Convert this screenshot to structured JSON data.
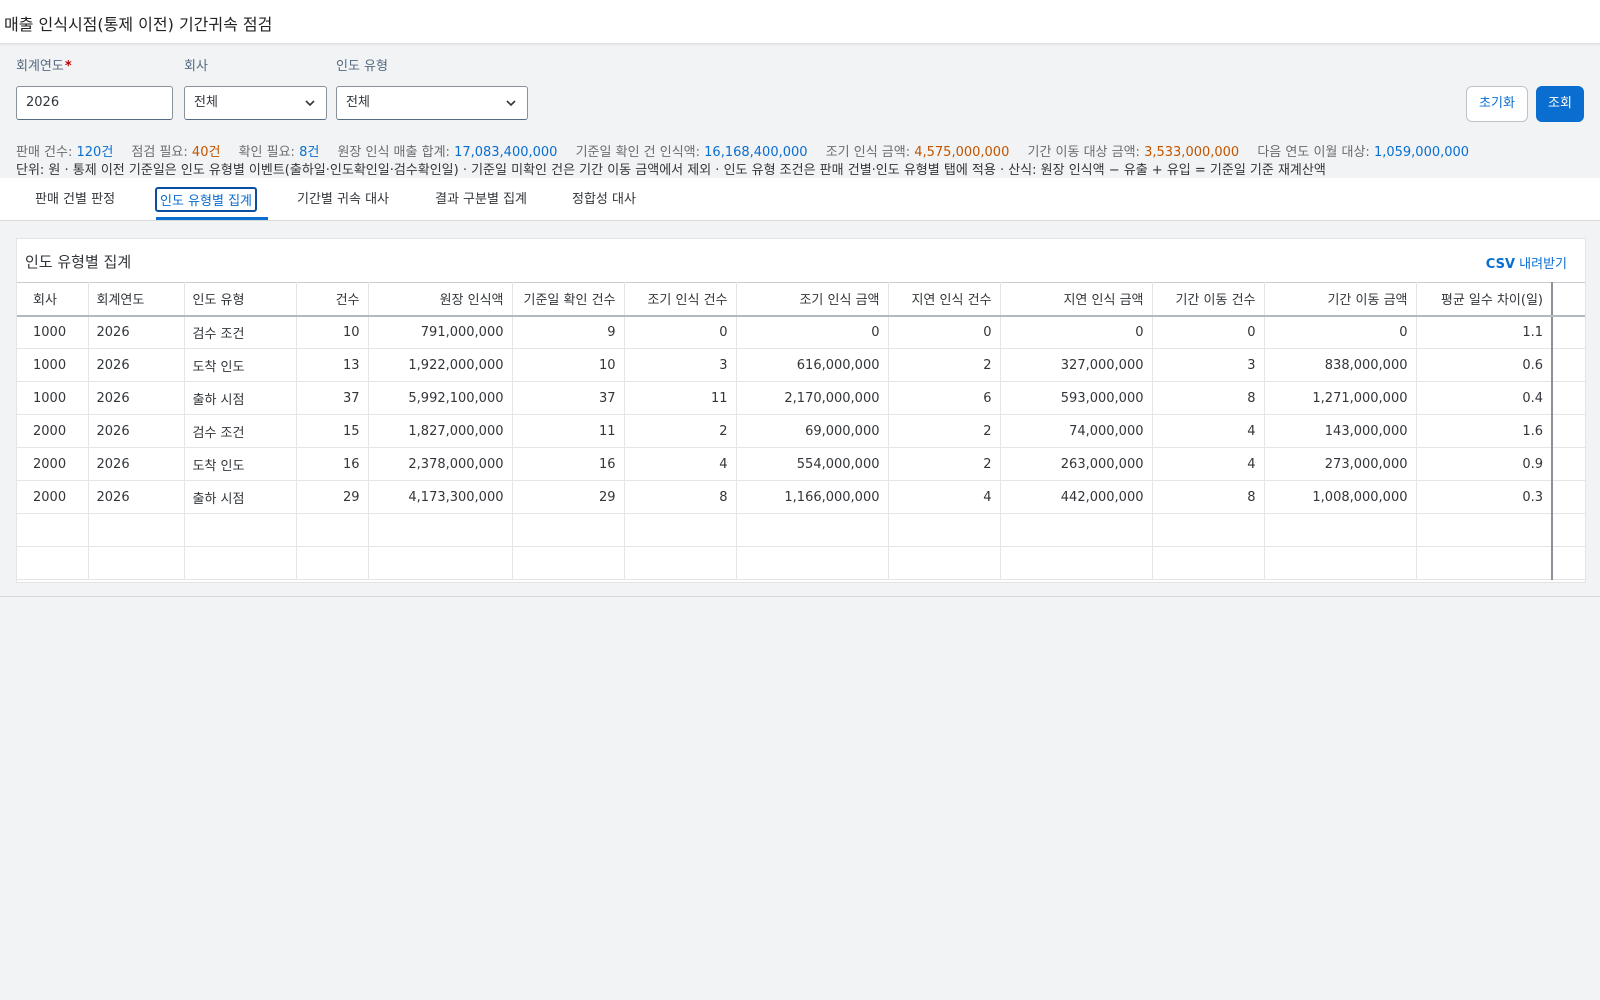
{
  "app": {
    "title": "매출 인식시점(통제 이전) 기간귀속 점검"
  },
  "filters": {
    "fiscal_year": {
      "label": "회계연도",
      "required_mark": "*",
      "value": "2026"
    },
    "company": {
      "label": "회사",
      "value": "전체"
    },
    "delivery_type": {
      "label": "인도 유형",
      "value": "전체"
    }
  },
  "buttons": {
    "reset": "초기화",
    "search": "조회"
  },
  "stats": [
    {
      "label": "판매 건수:",
      "value": "120건",
      "color": "#0a6ed1"
    },
    {
      "label": "점검 필요:",
      "value": "40건",
      "color": "#c35500"
    },
    {
      "label": "확인 필요:",
      "value": "8건",
      "color": "#0a6ed1"
    },
    {
      "label": "원장 인식 매출 합계:",
      "value": "17,083,400,000",
      "color": "#0a6ed1"
    },
    {
      "label": "기준일 확인 건 인식액:",
      "value": "16,168,400,000",
      "color": "#0a6ed1"
    },
    {
      "label": "조기 인식 금액:",
      "value": "4,575,000,000",
      "color": "#c35500"
    },
    {
      "label": "기간 이동 대상 금액:",
      "value": "3,533,000,000",
      "color": "#c35500"
    },
    {
      "label": "다음 연도 이월 대상:",
      "value": "1,059,000,000",
      "color": "#0a6ed1"
    }
  ],
  "unit_note": "단위: 원 · 통제 이전 기준일은 인도 유형별 이벤트(출하일·인도확인일·검수확인일) · 기준일 미확인 건은 기간 이동 금액에서 제외 · 인도 유형 조건은 판매 건별·인도 유형별 탭에 적용 · 산식: 원장 인식액 − 유출 + 유입 = 기준일 기준 재계산액",
  "tabs": {
    "by_sale": "판매 건별 판정",
    "by_delivery_type": "인도 유형별 집계",
    "by_period": "기간별 귀속 대사",
    "by_result": "결과 구분별 집계",
    "consistency": "정합성 대사",
    "active": "by_delivery_type"
  },
  "panel": {
    "title": "인도 유형별 집계",
    "csv_bold": "CSV",
    "csv_rest": " 내려받기"
  },
  "table": {
    "columns": [
      "회사",
      "회계연도",
      "인도 유형",
      "건수",
      "원장 인식액",
      "기준일 확인 건수",
      "조기 인식 건수",
      "조기 인식 금액",
      "지연 인식 건수",
      "지연 인식 금액",
      "기간 이동 건수",
      "기간 이동 금액",
      "평균 일수 차이(일)"
    ],
    "rows": [
      [
        "1000",
        "2026",
        "검수 조건",
        "10",
        "791,000,000",
        "9",
        "0",
        "0",
        "0",
        "0",
        "0",
        "0",
        "1.1"
      ],
      [
        "1000",
        "2026",
        "도착 인도",
        "13",
        "1,922,000,000",
        "10",
        "3",
        "616,000,000",
        "2",
        "327,000,000",
        "3",
        "838,000,000",
        "0.6"
      ],
      [
        "1000",
        "2026",
        "출하 시점",
        "37",
        "5,992,100,000",
        "37",
        "11",
        "2,170,000,000",
        "6",
        "593,000,000",
        "8",
        "1,271,000,000",
        "0.4"
      ],
      [
        "2000",
        "2026",
        "검수 조건",
        "15",
        "1,827,000,000",
        "11",
        "2",
        "69,000,000",
        "2",
        "74,000,000",
        "4",
        "143,000,000",
        "1.6"
      ],
      [
        "2000",
        "2026",
        "도착 인도",
        "16",
        "2,378,000,000",
        "16",
        "4",
        "554,000,000",
        "2",
        "263,000,000",
        "4",
        "273,000,000",
        "0.9"
      ],
      [
        "2000",
        "2026",
        "출하 시점",
        "29",
        "4,173,300,000",
        "29",
        "8",
        "1,166,000,000",
        "4",
        "442,000,000",
        "8",
        "1,008,000,000",
        "0.3"
      ]
    ],
    "empty_rows": 2
  }
}
